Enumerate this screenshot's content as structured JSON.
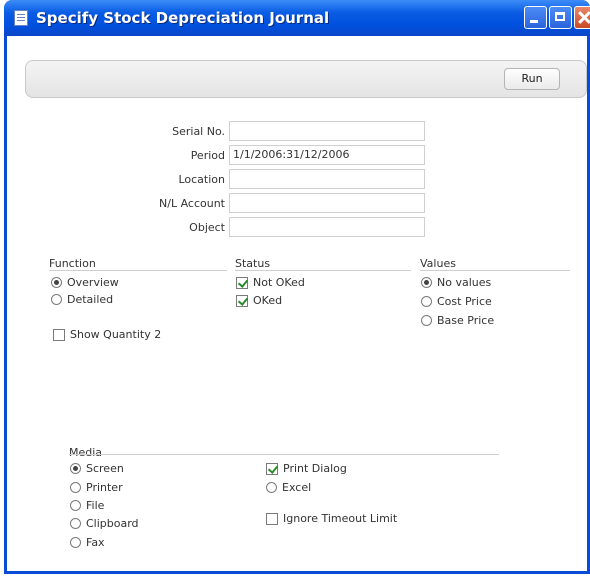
{
  "window": {
    "title": "Specify Stock Depreciation Journal"
  },
  "toolbar": {
    "run_label": "Run"
  },
  "fields": [
    {
      "label": "Serial No.",
      "value": ""
    },
    {
      "label": "Period",
      "value": "1/1/2006:31/12/2006"
    },
    {
      "label": "Location",
      "value": ""
    },
    {
      "label": "N/L Account",
      "value": ""
    },
    {
      "label": "Object",
      "value": ""
    }
  ],
  "function": {
    "title": "Function",
    "options": [
      {
        "label": "Overview",
        "selected": true
      },
      {
        "label": "Detailed",
        "selected": false
      }
    ],
    "show_quantity2": {
      "label": "Show Quantity 2",
      "checked": false
    }
  },
  "status": {
    "title": "Status",
    "options": [
      {
        "label": "Not OKed",
        "checked": true
      },
      {
        "label": "OKed",
        "checked": true
      }
    ]
  },
  "values": {
    "title": "Values",
    "options": [
      {
        "label": "No values",
        "selected": true
      },
      {
        "label": "Cost Price",
        "selected": false
      },
      {
        "label": "Base Price",
        "selected": false
      }
    ]
  },
  "media": {
    "title": "Media",
    "options": [
      {
        "label": "Screen",
        "selected": true
      },
      {
        "label": "Printer",
        "selected": false
      },
      {
        "label": "File",
        "selected": false
      },
      {
        "label": "Clipboard",
        "selected": false
      },
      {
        "label": "Fax",
        "selected": false
      }
    ],
    "print_dialog": {
      "label": "Print Dialog",
      "checked": true
    },
    "excel": {
      "label": "Excel",
      "selected": false
    },
    "ignore_timeout": {
      "label": "Ignore Timeout Limit",
      "checked": false
    }
  }
}
